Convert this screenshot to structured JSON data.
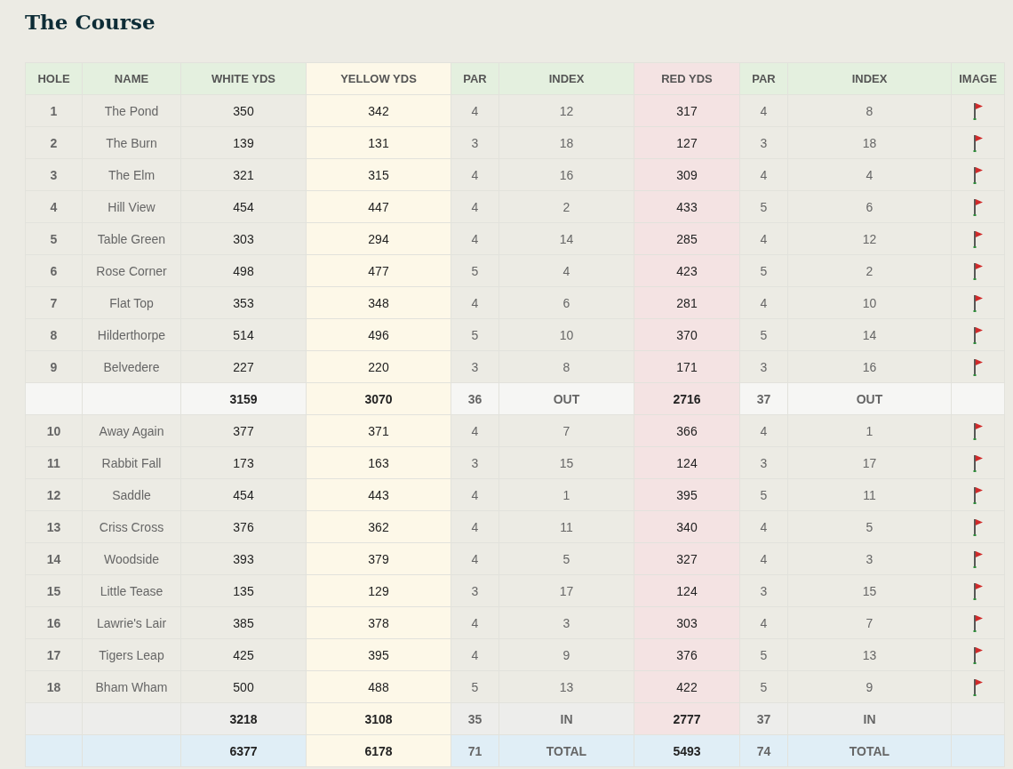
{
  "title": "The Course",
  "columns": [
    {
      "label": "HOLE",
      "kind": "plain"
    },
    {
      "label": "NAME",
      "kind": "plain"
    },
    {
      "label": "WHITE YDS",
      "kind": "plain"
    },
    {
      "label": "YELLOW YDS",
      "kind": "yellow"
    },
    {
      "label": "PAR",
      "kind": "plain"
    },
    {
      "label": "INDEX",
      "kind": "plain"
    },
    {
      "label": "RED YDS",
      "kind": "red"
    },
    {
      "label": "PAR",
      "kind": "plain"
    },
    {
      "label": "INDEX",
      "kind": "plain"
    },
    {
      "label": "IMAGE",
      "kind": "plain"
    }
  ],
  "rows": [
    {
      "kind": "hole",
      "cells": [
        "1",
        "The Pond",
        "350",
        "342",
        "4",
        "12",
        "317",
        "4",
        "8"
      ]
    },
    {
      "kind": "hole",
      "cells": [
        "2",
        "The Burn",
        "139",
        "131",
        "3",
        "18",
        "127",
        "3",
        "18"
      ]
    },
    {
      "kind": "hole",
      "cells": [
        "3",
        "The Elm",
        "321",
        "315",
        "4",
        "16",
        "309",
        "4",
        "4"
      ]
    },
    {
      "kind": "hole",
      "cells": [
        "4",
        "Hill View",
        "454",
        "447",
        "4",
        "2",
        "433",
        "5",
        "6"
      ]
    },
    {
      "kind": "hole",
      "cells": [
        "5",
        "Table Green",
        "303",
        "294",
        "4",
        "14",
        "285",
        "4",
        "12"
      ]
    },
    {
      "kind": "hole",
      "cells": [
        "6",
        "Rose Corner",
        "498",
        "477",
        "5",
        "4",
        "423",
        "5",
        "2"
      ]
    },
    {
      "kind": "hole",
      "cells": [
        "7",
        "Flat Top",
        "353",
        "348",
        "4",
        "6",
        "281",
        "4",
        "10"
      ]
    },
    {
      "kind": "hole",
      "cells": [
        "8",
        "Hilderthorpe",
        "514",
        "496",
        "5",
        "10",
        "370",
        "5",
        "14"
      ]
    },
    {
      "kind": "hole",
      "cells": [
        "9",
        "Belvedere",
        "227",
        "220",
        "3",
        "8",
        "171",
        "3",
        "16"
      ]
    },
    {
      "kind": "out",
      "cells": [
        "3159",
        "3070",
        "36",
        "OUT",
        "2716",
        "37",
        "OUT"
      ]
    },
    {
      "kind": "hole",
      "cells": [
        "10",
        "Away Again",
        "377",
        "371",
        "4",
        "7",
        "366",
        "4",
        "1"
      ]
    },
    {
      "kind": "hole",
      "cells": [
        "11",
        "Rabbit Fall",
        "173",
        "163",
        "3",
        "15",
        "124",
        "3",
        "17"
      ]
    },
    {
      "kind": "hole",
      "cells": [
        "12",
        "Saddle",
        "454",
        "443",
        "4",
        "1",
        "395",
        "5",
        "11"
      ]
    },
    {
      "kind": "hole",
      "cells": [
        "13",
        "Criss Cross",
        "376",
        "362",
        "4",
        "11",
        "340",
        "4",
        "5"
      ]
    },
    {
      "kind": "hole",
      "cells": [
        "14",
        "Woodside",
        "393",
        "379",
        "4",
        "5",
        "327",
        "4",
        "3"
      ]
    },
    {
      "kind": "hole",
      "cells": [
        "15",
        "Little Tease",
        "135",
        "129",
        "3",
        "17",
        "124",
        "3",
        "15"
      ]
    },
    {
      "kind": "hole",
      "cells": [
        "16",
        "Lawrie's Lair",
        "385",
        "378",
        "4",
        "3",
        "303",
        "4",
        "7"
      ]
    },
    {
      "kind": "hole",
      "cells": [
        "17",
        "Tigers Leap",
        "425",
        "395",
        "4",
        "9",
        "376",
        "5",
        "13"
      ]
    },
    {
      "kind": "hole",
      "cells": [
        "18",
        "Bham Wham",
        "500",
        "488",
        "5",
        "13",
        "422",
        "5",
        "9"
      ]
    },
    {
      "kind": "in",
      "cells": [
        "3218",
        "3108",
        "35",
        "IN",
        "2777",
        "37",
        "IN"
      ]
    },
    {
      "kind": "total",
      "cells": [
        "6377",
        "6178",
        "71",
        "TOTAL",
        "5493",
        "74",
        "TOTAL"
      ]
    }
  ]
}
